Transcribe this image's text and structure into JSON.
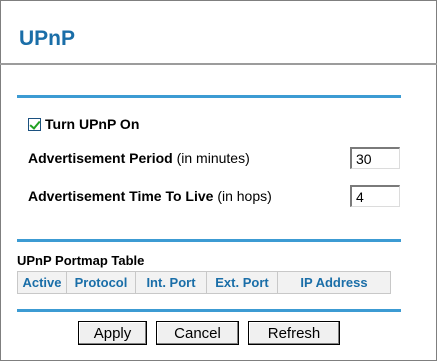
{
  "page": {
    "title": "UPnP"
  },
  "settings": {
    "turn_on_label": "Turn UPnP On",
    "turn_on_checked": true,
    "adv_period_label_bold": "Advertisement Period",
    "adv_period_label_unit": " (in minutes)",
    "adv_period_value": "30",
    "adv_ttl_label_bold": "Advertisement Time To Live",
    "adv_ttl_label_unit": " (in hops)",
    "adv_ttl_value": "4"
  },
  "portmap": {
    "title": "UPnP Portmap Table",
    "columns": [
      "Active",
      "Protocol",
      "Int. Port",
      "Ext. Port",
      "IP Address"
    ]
  },
  "buttons": {
    "apply": "Apply",
    "cancel": "Cancel",
    "refresh": "Refresh"
  },
  "colors": {
    "accent": "#1a6ea8",
    "rule": "#3c9bd3",
    "check": "#21a121"
  }
}
